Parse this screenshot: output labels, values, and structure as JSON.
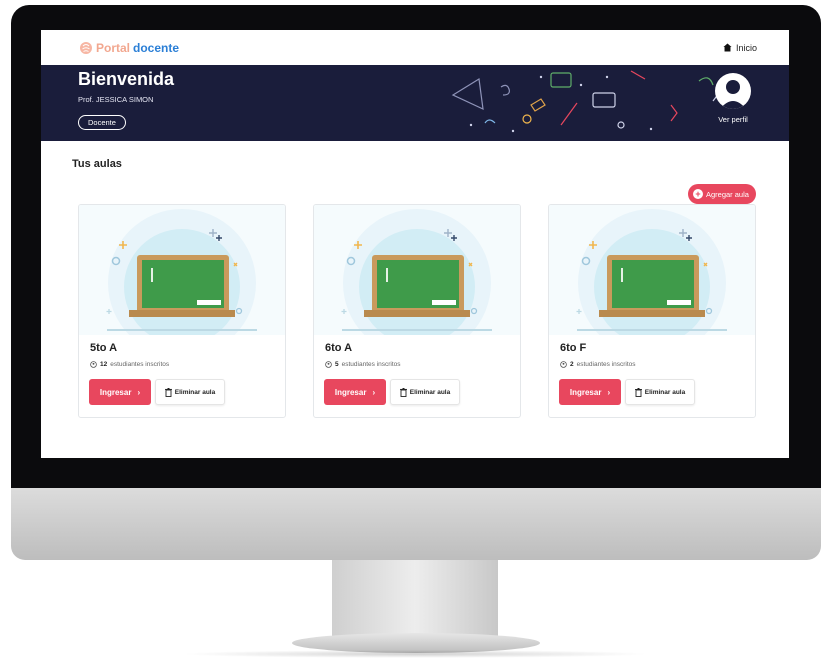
{
  "brand": {
    "word1": "Portal",
    "word2": "docente"
  },
  "nav": {
    "home_label": "Inicio"
  },
  "hero": {
    "welcome": "Bienvenida",
    "teacher": "Prof. JESSICA SIMON",
    "role": "Docente",
    "profile_link": "Ver perfil"
  },
  "classrooms": {
    "title": "Tus aulas",
    "add_label": "Agregar aula",
    "enter_label": "Ingresar",
    "remove_label": "Eliminar aula",
    "students_suffix": "estudiantes inscritos",
    "items": [
      {
        "name": "5to A",
        "count": "12"
      },
      {
        "name": "6to A",
        "count": "5"
      },
      {
        "name": "6to F",
        "count": "2"
      }
    ]
  },
  "colors": {
    "accent": "#e8475e",
    "hero_bg": "#1a1d3b",
    "board": "#3f9b4a",
    "board_frame": "#c99a5c"
  },
  "icons": {
    "brand": "brain-icon",
    "home": "home-icon",
    "avatar": "user-avatar-icon",
    "add": "plus-icon",
    "students": "users-icon",
    "remove": "trash-icon",
    "enter": "chevron-right-icon"
  }
}
